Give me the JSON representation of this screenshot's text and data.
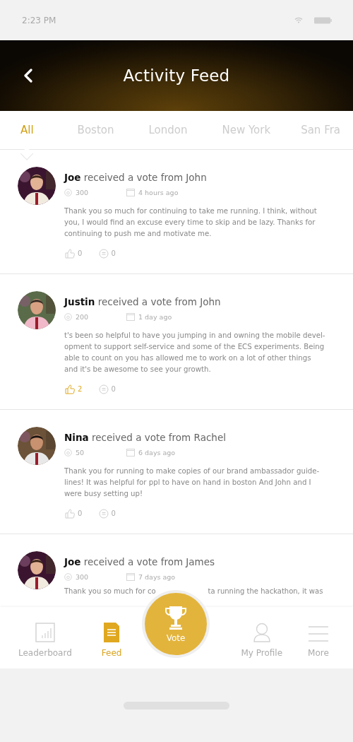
{
  "status_bar": {
    "time": "2:23 PM"
  },
  "header": {
    "title": "Activity Feed"
  },
  "tabs": [
    {
      "label": "All",
      "selected": true
    },
    {
      "label": "Boston",
      "selected": false
    },
    {
      "label": "London",
      "selected": false
    },
    {
      "label": "New York",
      "selected": false
    },
    {
      "label": "San Fra",
      "selected": false
    }
  ],
  "posts": [
    {
      "avatar": {
        "kind": "picture"
      },
      "recipient": "Joe",
      "action": "received a vote from John",
      "points": "300",
      "time": "4 hours ago",
      "body_lines": [
        "Thank you so much for continuing to take me running. I think, without",
        "you, I would find an excuse every time to skip and be lazy. Thanks for",
        "continuing to push me and motivate me."
      ],
      "likes": "0",
      "liked": false,
      "comments": "0"
    },
    {
      "avatar": {
        "kind": "picture"
      },
      "recipient": "Justin",
      "action": "received a vote from John",
      "points": "200",
      "time": "1 day ago",
      "body_lines": [
        "t's been so helpful to have you jumping in and owning the mobile devel-",
        "opment to support self-service and some of the ECS experiments. Being",
        "able to count on you has allowed me to work on a lot of other things",
        "and it's be awesome to see your growth."
      ],
      "likes": "2",
      "liked": true,
      "comments": "0"
    },
    {
      "avatar": {
        "kind": "picture"
      },
      "recipient": "Nina",
      "action": "received a vote from Rachel",
      "points": "50",
      "time": "6 days ago",
      "body_lines": [
        "Thank you for running to make copies of our brand ambassador guide-",
        "lines! It was helpful for ppl to have on hand in boston And John and I",
        "were busy setting up!"
      ],
      "likes": "0",
      "liked": false,
      "comments": "0"
    },
    {
      "avatar": {
        "kind": "picture"
      },
      "recipient": "Joe",
      "action": "received a vote from James",
      "points": "300",
      "time": "7 days ago",
      "body_parts": [
        "Thank you so much for co",
        "ta running the hackathon, it was"
      ]
    }
  ],
  "bottom_nav": [
    {
      "kind": "leaderboard",
      "label": "Leaderboard",
      "selected": false
    },
    {
      "kind": "feed",
      "label": "Feed",
      "selected": true
    },
    {
      "kind": "vote",
      "label": "Vote",
      "selected": false
    },
    {
      "kind": "profile",
      "label": "My Profile",
      "selected": false
    },
    {
      "kind": "more",
      "label": "More",
      "selected": false
    }
  ]
}
